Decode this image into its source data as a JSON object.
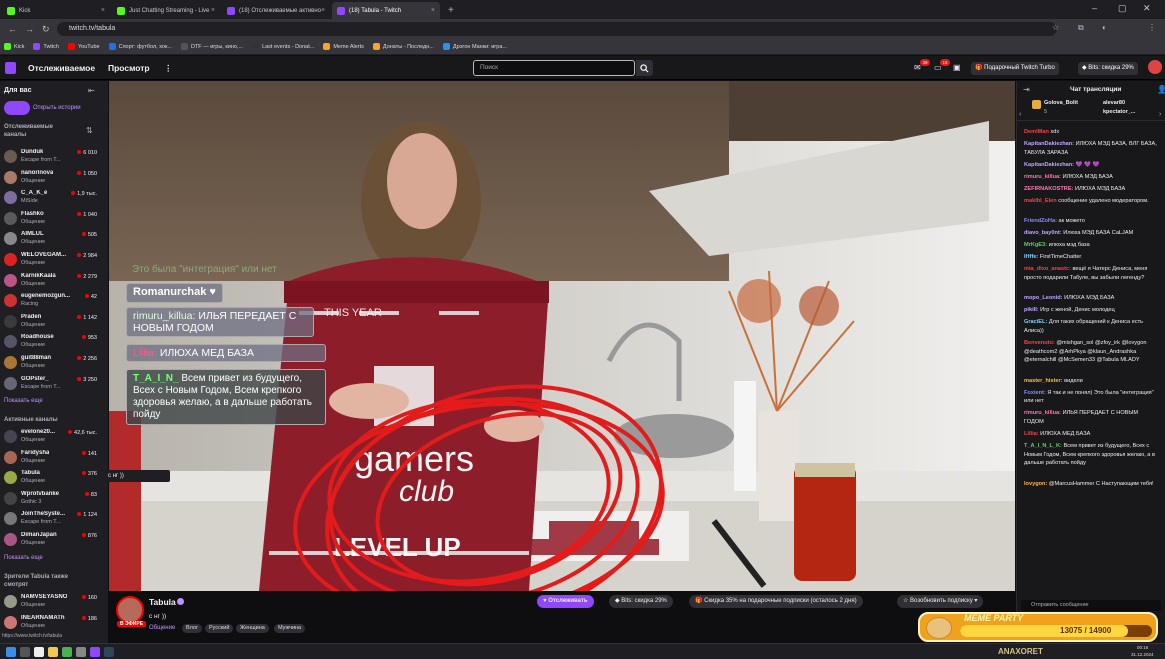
{
  "browser": {
    "tabs": [
      {
        "label": "Kick",
        "color": "#53fc18"
      },
      {
        "label": "Just Chatting Streaming - Live",
        "color": "#53fc18"
      },
      {
        "label": "(18) Отслеживаемые активно",
        "color": "#9147ff"
      },
      {
        "label": "(18) Tabula - Twitch",
        "color": "#9147ff"
      }
    ],
    "url": "twitch.tv/tabula",
    "bookmarks": [
      {
        "label": "Kick",
        "color": "#53fc18"
      },
      {
        "label": "Twitch",
        "color": "#9147ff"
      },
      {
        "label": "YouTube",
        "color": "#ff0000"
      },
      {
        "label": "Спорт: футбол, хок...",
        "color": "#1a73e8"
      },
      {
        "label": "DTF — игры, кино,...",
        "color": "#444"
      },
      {
        "label": "Last events - Donat...",
        "color": "#333"
      },
      {
        "label": "Meme Alerts",
        "color": "#f5a623"
      },
      {
        "label": "Донаты - Последн...",
        "color": "#f5a623"
      },
      {
        "label": "Дрэгон Манки: игра...",
        "color": "#2196f3"
      }
    ]
  },
  "topnav": {
    "following": "Отслеживаемое",
    "browse": "Просмотр",
    "more": "⋮",
    "search_placeholder": "Поиск",
    "notif_count": "39",
    "inbox_count": "16",
    "turbo": "Подарочный Twitch Turbo",
    "bits": "Bits: скидка 29%"
  },
  "sidebar": {
    "for_you": "Для вас",
    "stories": "Открыть истории",
    "followed_header": "Отслеживаемые каналы",
    "followed": [
      {
        "name": "Dunduk",
        "game": "Escape from T...",
        "count": "6 010",
        "color": "#6b5a4e"
      },
      {
        "name": "nanorinova",
        "game": "Общение",
        "count": "1 050",
        "color": "#a87a6a"
      },
      {
        "name": "C_A_K_e",
        "game": "MiSide",
        "count": "1,9 тыс.",
        "color": "#7c6fa0"
      },
      {
        "name": "Flashko",
        "game": "Общение",
        "count": "1 040",
        "color": "#5a5a5a"
      },
      {
        "name": "AIMLUL",
        "game": "Общение",
        "count": "505",
        "color": "#888"
      },
      {
        "name": "WELOVEGAM...",
        "game": "Общение",
        "count": "2 984",
        "color": "#d22"
      },
      {
        "name": "KarnikKaaIa",
        "game": "Общение",
        "count": "2 279",
        "color": "#b58"
      },
      {
        "name": "eugenemozgun...",
        "game": "Racing",
        "count": "42",
        "color": "#c33"
      },
      {
        "name": "Praden",
        "game": "Общение",
        "count": "1 142",
        "color": "#3a3a3a"
      },
      {
        "name": "Roadhouse",
        "game": "Общение",
        "count": "953",
        "color": "#556"
      },
      {
        "name": "guit88man",
        "game": "Общение",
        "count": "2 256",
        "color": "#a73"
      },
      {
        "name": "GOPster_",
        "game": "Escape from T...",
        "count": "3 250",
        "color": "#667"
      }
    ],
    "show_more": "Показать еще",
    "active_header": "Активные каналы",
    "active": [
      {
        "name": "evelone20...",
        "game": "Общение",
        "count": "42,6 тыс.",
        "color": "#445"
      },
      {
        "name": "Faridysha",
        "game": "Общение",
        "count": "141",
        "color": "#a65"
      },
      {
        "name": "Tabula",
        "game": "Общение",
        "count": "376",
        "color": "#9a4"
      },
      {
        "name": "Wprotvbanke",
        "game": "Gothic 3",
        "count": "83",
        "color": "#444"
      },
      {
        "name": "JoinTheSyste...",
        "game": "Escape from T...",
        "count": "1 124",
        "color": "#777"
      },
      {
        "name": "DimanJapan",
        "game": "Общение",
        "count": "876",
        "color": "#a58"
      }
    ],
    "show_more2": "Показать еще",
    "viewers_header": "Зрители Tabula также смотрят",
    "viewers": [
      {
        "name": "NAMVSEYASNO",
        "game": "Общение",
        "count": "160",
        "color": "#998"
      },
      {
        "name": "INEARNAMATh",
        "game": "Общение",
        "count": "186",
        "color": "#c77"
      }
    ],
    "status_url": "https://www.twitch.tv/tabula"
  },
  "overlay_chat": [
    {
      "user": "",
      "text": "Это была \"интеграция\" или нет"
    },
    {
      "user": "Romanurchak",
      "text": "♥"
    },
    {
      "user": "rimuru_killua:",
      "text": "ИЛЬЯ ПЕРЕДАЕТ С НОВЫМ ГОДОМ"
    },
    {
      "user": "Lillia:",
      "text": "ИЛЮХА МЕД БАЗА"
    },
    {
      "user": "T_A_I_N_",
      "text": "Всем привет из будущего, Всех с Новым Годом, Всем крепкого здоровья желаю, а в дальше работать пойду"
    }
  ],
  "video": {
    "sweater_top": "THIS YEAR",
    "sweater_brand1": "gamers",
    "sweater_brand2": "club",
    "sweater_bottom": "LEVEL UP",
    "hover_tooltip": "с нг ))"
  },
  "streamer": {
    "name": "Tabula",
    "live_label": "В ЭФИРЕ",
    "title": "с нг ))",
    "category": "Общение",
    "tags": [
      "Влог",
      "Русский",
      "Женщина",
      "Мужчина"
    ],
    "follow_btn": "Отслеживать",
    "bits_btn": "Bits: скидка 29%",
    "gift_btn": "Скидка 35% на подарочные подписки (осталось 2 дня)",
    "resub_btn": "Возобновить подписку"
  },
  "chat": {
    "header": "Чат трансляции",
    "leaders": [
      {
        "name": "Golova_Bolit",
        "n": "5"
      },
      {
        "name": "alevar80",
        "n": "2"
      },
      {
        "name": "kpectator_...",
        "n": ""
      }
    ],
    "messages": [
      {
        "user": "DemiMan",
        "color": "#ff4040",
        "text": "xdx"
      },
      {
        "user": "KapitanDakiezhan:",
        "color": "#c1a6ff",
        "text": "ИЛЮХА МЭД БАЗА, ВЛГ БАЗА, ТАБУЛА ЗАРАЗА"
      },
      {
        "user": "KapitanDakiezhan:",
        "color": "#c1a6ff",
        "text": "💜 💜 💜"
      },
      {
        "user": "rimuru_killua:",
        "color": "#ff7ab4",
        "text": "ИЛЮХА МЭД БАЗА"
      },
      {
        "user": "ZEFIRNAKOSTRE:",
        "color": "#ff7ab4",
        "text": "ИЛЮХА МЭД БАЗА"
      },
      {
        "user": "maklbl_Elen",
        "color": "#ff4040",
        "text": "сообщение удалено модератором."
      },
      {
        "user": "FriendZoHa:",
        "color": "#8a8aff",
        "text": "ак можето"
      },
      {
        "user": "diavo_bay0nt:",
        "color": "#c1a6ff",
        "text": "Илюха МЭД БАЗА СаLJAM"
      },
      {
        "user": "MrKgE3:",
        "color": "#5fd35f",
        "text": "илюха мэд база"
      },
      {
        "user": "lHffe:",
        "color": "#7fd1ff",
        "text": "FirstTimeChatter"
      },
      {
        "user": "mia_dixo_anastc:",
        "color": "#ff4040",
        "text": "вещё я Чатерс Дениса, меня просто подарили Табуле, вы забыли легенду?"
      },
      {
        "user": "mopo_Leonid:",
        "color": "#c1a6ff",
        "text": "ИЛЮХА МЭД БАЗА"
      },
      {
        "user": "pikiII:",
        "color": "#c1a6ff",
        "text": "Игр с женой, Денис молодец"
      },
      {
        "user": "GraciEL:",
        "color": "#7fd1ff",
        "text": "Для таких обращений к Дениса есть Алиса))"
      },
      {
        "user": "Benvenuto:",
        "color": "#ff4040",
        "text": "@mishgan_sol @zfoy_irk @lovygon @deathcom2 @ArhPkya @klaun_Andrashka @eternalchill @McSemen33 @Tabula MLADY"
      },
      {
        "user": "master_hister:",
        "color": "#ffb84d",
        "text": "видели"
      },
      {
        "user": "Foxient:",
        "color": "#8a8aff",
        "text": "Я так и не понял) Это была \"интеграция\" или нет"
      },
      {
        "user": "rimuru_killua:",
        "color": "#ff7ab4",
        "text": "ИЛЬЯ ПЕРЕДАЕТ С НОВЫМ ГОДОМ"
      },
      {
        "user": "Lillia:",
        "color": "#ff4040",
        "text": "ИЛЮХА МЕД БАЗА"
      },
      {
        "user": "T_A_I_N_L_K:",
        "color": "#5fd35f",
        "text": "Всем привет из будущего, Всех с Новым Годом, Всем крепкого здоровья желаю, а в дальше работать пойду"
      },
      {
        "user": "lovygon:",
        "color": "#ffb84d",
        "text": "@MarcusHammer С Наступающим тебя!"
      }
    ],
    "input_placeholder": "Отправить сообщение"
  },
  "meme_party": {
    "title": "MEME PARTY",
    "progress_text": "13075 / 14900",
    "progress": 0.877
  },
  "taskbar": {
    "right_text": "ANAXORET",
    "time": "00:16",
    "date": "31.12.2024"
  }
}
